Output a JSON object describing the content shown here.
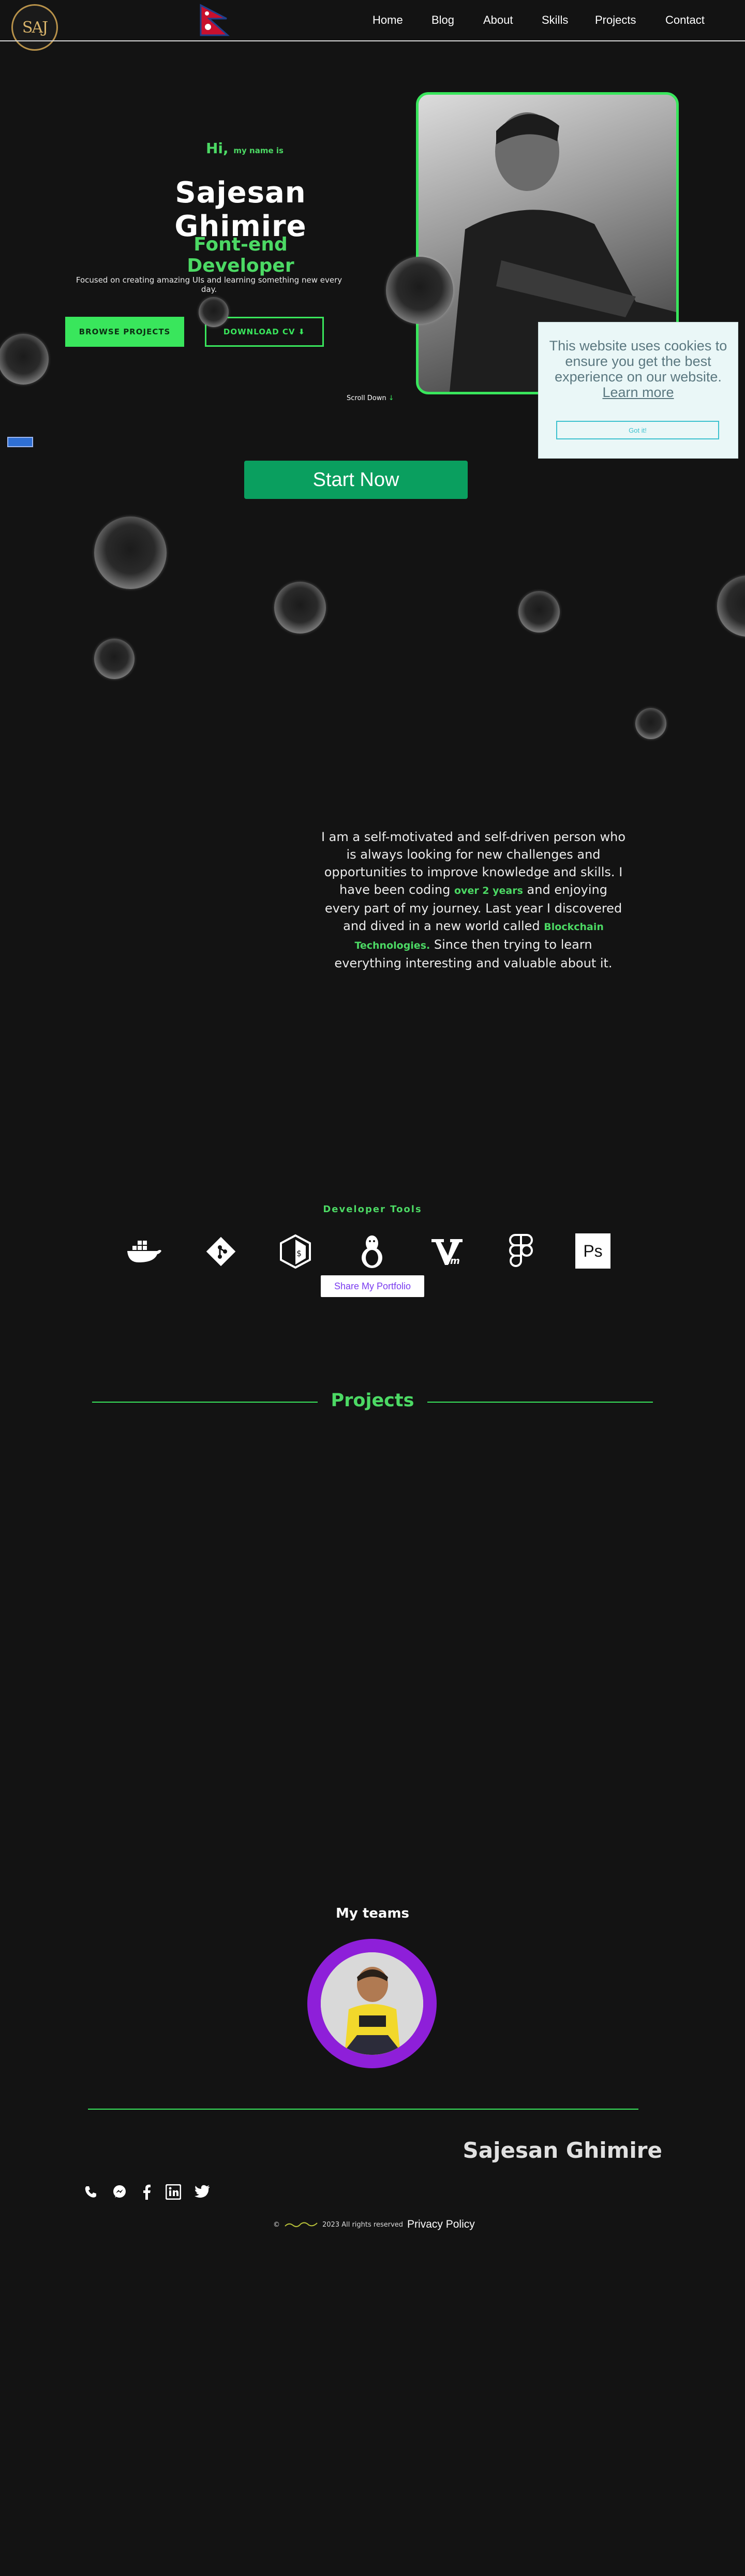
{
  "header": {
    "logo_text": "SAJ",
    "nav": [
      {
        "label": "Home"
      },
      {
        "label": "Blog"
      },
      {
        "label": "About"
      },
      {
        "label": "Skills"
      },
      {
        "label": "Projects"
      },
      {
        "label": "Contact"
      }
    ]
  },
  "hero": {
    "greeting": "Hi,",
    "greeting_small": "my name is",
    "name": "Sajesan Ghimire",
    "role": "Font-end Developer",
    "description": "Focused on creating amazing UIs and learning something new every day.",
    "browse_button": "BROWSE PROJECTS",
    "cv_button": "DOWNLOAD CV",
    "scroll_label": "Scroll Down"
  },
  "cookie_banner": {
    "text": "This website uses cookies to ensure you get the best experience on our website.",
    "learn_more": "Learn more",
    "button": "Got it!"
  },
  "cta": {
    "start_button": "Start Now"
  },
  "about": {
    "text_1": "I am a self-motivated and self-driven person who is always looking for new challenges and opportunities to improve knowledge and skills. I have been coding ",
    "highlight_1": "over 2 years",
    "text_2": " and enjoying every part of my journey. Last year I discovered and dived in a new world called ",
    "highlight_2": "Blockchain Technologies.",
    "text_3": " Since then trying to learn everything interesting and valuable about it."
  },
  "tools": {
    "title": "Developer Tools",
    "items": [
      "docker-icon",
      "git-icon",
      "bash-icon",
      "linux-icon",
      "vim-icon",
      "figma-icon",
      "photoshop-icon"
    ],
    "ps_label": "Ps",
    "share_button": "Share My Portfolio"
  },
  "projects": {
    "title": "Projects"
  },
  "teams": {
    "title": "My teams"
  },
  "footer": {
    "name": "Sajesan Ghimire",
    "socials": [
      "phone-icon",
      "messenger-icon",
      "facebook-icon",
      "linkedin-icon",
      "twitter-icon"
    ],
    "copyright_symbol": "©",
    "copyright": "2023 All rights reserved",
    "privacy": "Privacy Policy"
  },
  "colors": {
    "accent": "#39e65c",
    "background": "#131313",
    "cta": "#0a9f5f",
    "team_ring": "#8e1fd9"
  }
}
